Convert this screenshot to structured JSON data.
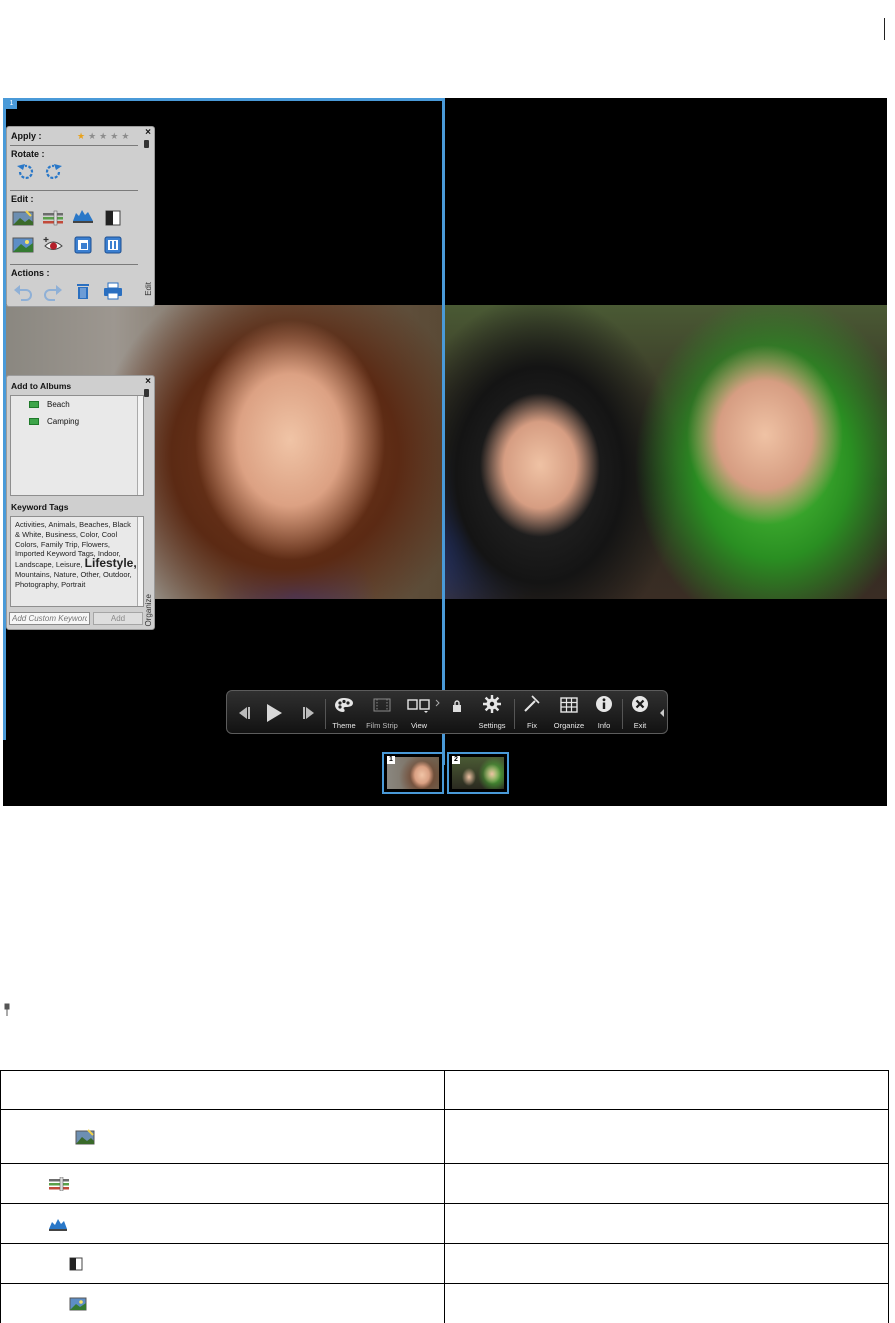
{
  "slideshow": {
    "selected_slide_number": "1",
    "edit_panel": {
      "apply_label": "Apply :",
      "rating": 1,
      "rating_max": 5,
      "rotate_label": "Rotate :",
      "edit_label": "Edit :",
      "actions_label": "Actions :",
      "side_label": "Edit",
      "close_glyph": "×",
      "icons": [
        "rotate-left-icon",
        "rotate-right-icon",
        "auto-smart-fix-icon",
        "auto-color-icon",
        "auto-levels-icon",
        "auto-contrast-icon",
        "auto-sharpen-icon",
        "red-eye-fix-icon",
        "crop-icon",
        "add-to-slideshow-icon",
        "undo-icon",
        "redo-icon",
        "delete-icon",
        "print-icon"
      ]
    },
    "organize_panel": {
      "albums_title": "Add to Albums",
      "albums": [
        "Beach",
        "Camping"
      ],
      "keywords_title": "Keyword Tags",
      "tags_before_big": "Activities,  Animals,  Beaches, Black & White,  Business, Color,  Cool Colors, Family Trip,  Flowers, Imported Keyword Tags, Indoor,  Landscape,  Leisure,",
      "tags_big": "Lifestyle,",
      "tags_after_big": " Mountains, Nature,  Other,  Outdoor, Photography,  Portrait",
      "keyword_input_placeholder": "Add Custom Keywords",
      "add_button": "Add",
      "side_label": "Organize",
      "close_glyph": "×"
    },
    "control_bar": {
      "buttons": {
        "previous": "",
        "play": "",
        "next": "",
        "theme": "Theme",
        "film_strip": "Film Strip",
        "view": "View",
        "lock": "",
        "settings": "Settings",
        "fix": "Fix",
        "organize": "Organize",
        "info": "Info",
        "exit": "Exit"
      }
    },
    "thumbnails": [
      {
        "number": "1",
        "selected": true
      },
      {
        "number": "2",
        "selected": false
      }
    ]
  },
  "icon_table": {
    "rows": [
      {
        "icon": "auto-smart-fix-icon"
      },
      {
        "icon": "auto-color-icon"
      },
      {
        "icon": "auto-levels-icon"
      },
      {
        "icon": "auto-contrast-icon"
      },
      {
        "icon": "auto-sharpen-icon"
      }
    ]
  },
  "colors": {
    "selection": "#4a9ad8",
    "panel_bg": "#cfcfcf",
    "star_on": "#e8a21d",
    "album_green": "#3ea54a"
  }
}
